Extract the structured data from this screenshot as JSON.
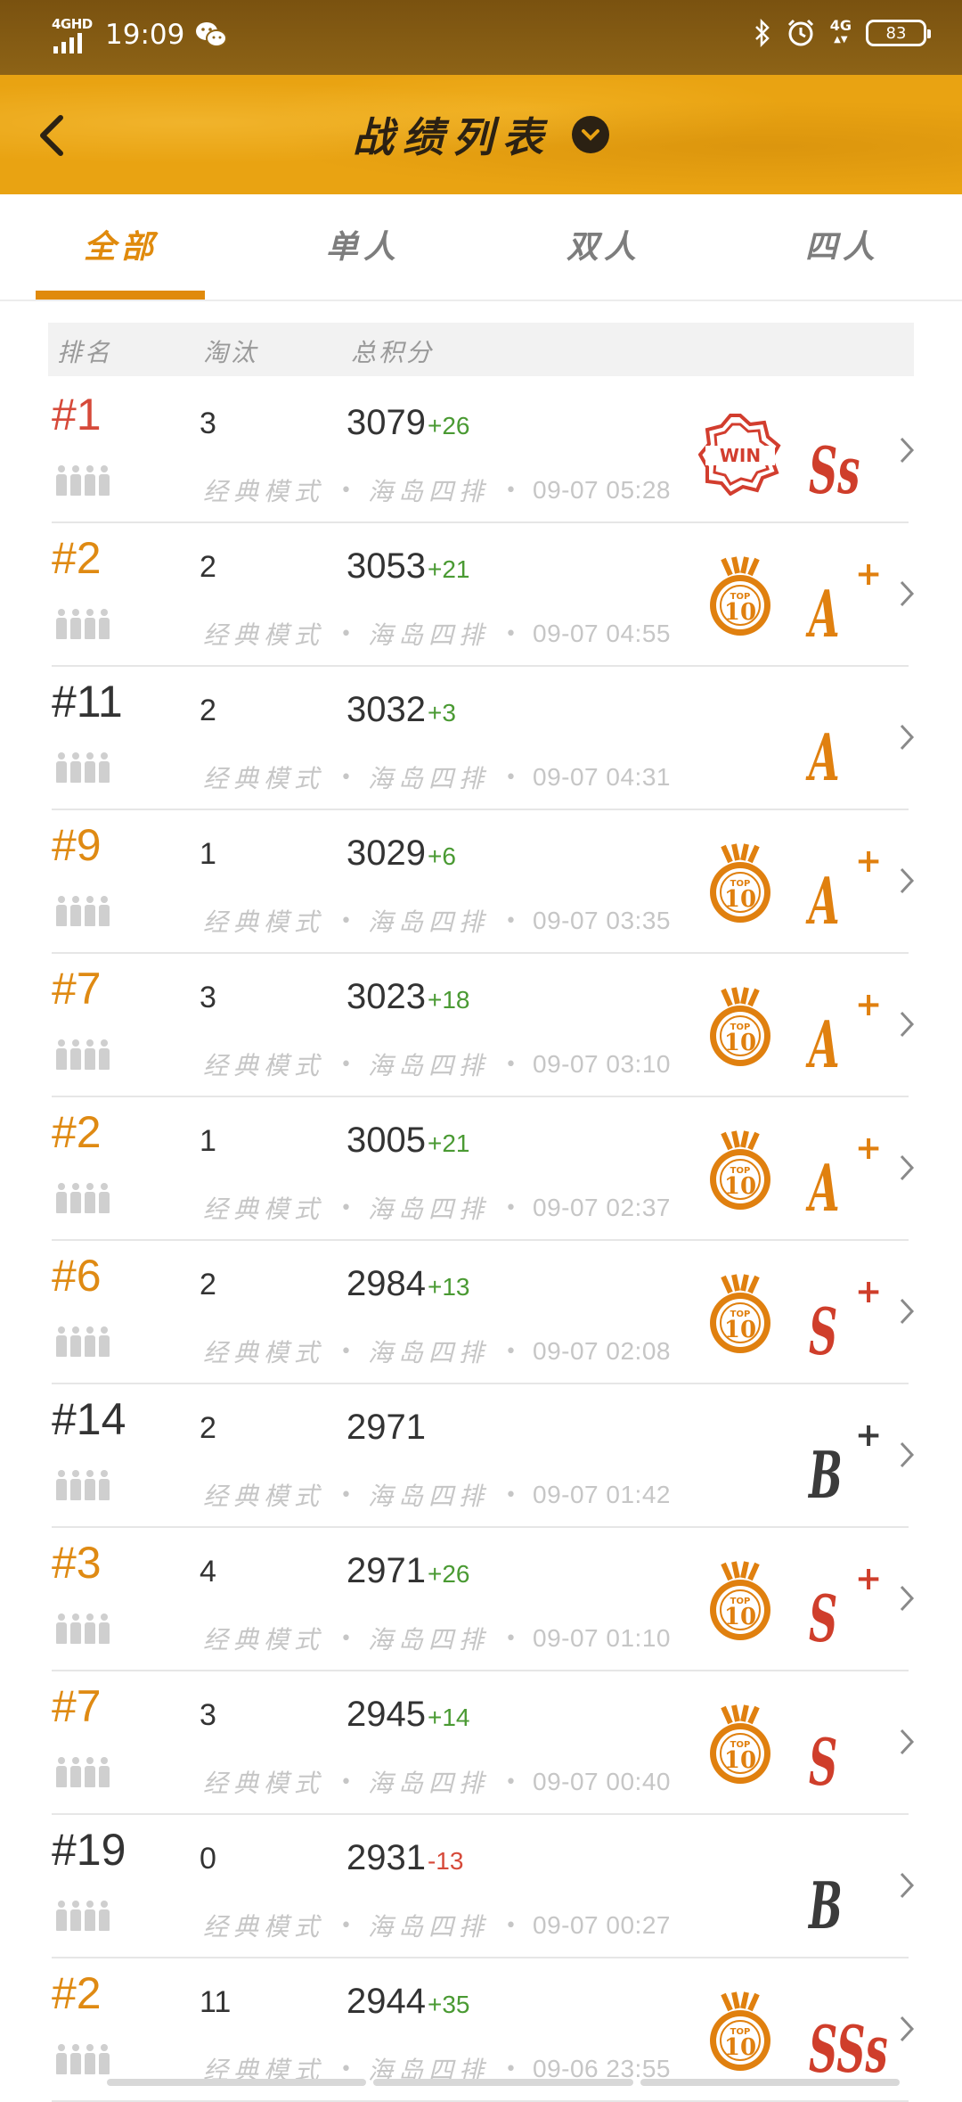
{
  "status_bar": {
    "network": "4GHD",
    "time": "19:09",
    "network_right": "4G",
    "battery": "83",
    "icons": [
      "signal-icon",
      "wechat-icon",
      "bluetooth-icon",
      "alarm-icon",
      "battery-icon"
    ]
  },
  "header": {
    "title": "战绩列表",
    "back_icon": "back-arrow-icon",
    "dropdown_icon": "chevron-down-circle-icon"
  },
  "tabs": [
    {
      "label": "全部",
      "active": true
    },
    {
      "label": "单人",
      "active": false
    },
    {
      "label": "双人",
      "active": false
    },
    {
      "label": "四人",
      "active": false
    }
  ],
  "table_header": {
    "rank": "排名",
    "kills": "淘汰",
    "score": "总积分"
  },
  "rows": [
    {
      "rank": "#1",
      "rank_color": "red",
      "kills": "3",
      "score": "3079",
      "delta": "+26",
      "delta_sign": "pos",
      "mode": "经典模式",
      "map": "海岛四排",
      "time": "09-07 05:28",
      "badge": "win",
      "grade": "Ss",
      "grade_plus": "",
      "grade_color": "red"
    },
    {
      "rank": "#2",
      "rank_color": "gold",
      "kills": "2",
      "score": "3053",
      "delta": "+21",
      "delta_sign": "pos",
      "mode": "经典模式",
      "map": "海岛四排",
      "time": "09-07 04:55",
      "badge": "top10",
      "grade": "A",
      "grade_plus": "+",
      "grade_color": "orange"
    },
    {
      "rank": "#11",
      "rank_color": "dark",
      "kills": "2",
      "score": "3032",
      "delta": "+3",
      "delta_sign": "pos",
      "mode": "经典模式",
      "map": "海岛四排",
      "time": "09-07 04:31",
      "badge": "none",
      "grade": "A",
      "grade_plus": "",
      "grade_color": "orange"
    },
    {
      "rank": "#9",
      "rank_color": "gold",
      "kills": "1",
      "score": "3029",
      "delta": "+6",
      "delta_sign": "pos",
      "mode": "经典模式",
      "map": "海岛四排",
      "time": "09-07 03:35",
      "badge": "top10",
      "grade": "A",
      "grade_plus": "+",
      "grade_color": "orange"
    },
    {
      "rank": "#7",
      "rank_color": "gold",
      "kills": "3",
      "score": "3023",
      "delta": "+18",
      "delta_sign": "pos",
      "mode": "经典模式",
      "map": "海岛四排",
      "time": "09-07 03:10",
      "badge": "top10",
      "grade": "A",
      "grade_plus": "+",
      "grade_color": "orange"
    },
    {
      "rank": "#2",
      "rank_color": "gold",
      "kills": "1",
      "score": "3005",
      "delta": "+21",
      "delta_sign": "pos",
      "mode": "经典模式",
      "map": "海岛四排",
      "time": "09-07 02:37",
      "badge": "top10",
      "grade": "A",
      "grade_plus": "+",
      "grade_color": "orange"
    },
    {
      "rank": "#6",
      "rank_color": "gold",
      "kills": "2",
      "score": "2984",
      "delta": "+13",
      "delta_sign": "pos",
      "mode": "经典模式",
      "map": "海岛四排",
      "time": "09-07 02:08",
      "badge": "top10",
      "grade": "S",
      "grade_plus": "+",
      "grade_color": "red"
    },
    {
      "rank": "#14",
      "rank_color": "dark",
      "kills": "2",
      "score": "2971",
      "delta": "",
      "delta_sign": "pos",
      "mode": "经典模式",
      "map": "海岛四排",
      "time": "09-07 01:42",
      "badge": "none",
      "grade": "B",
      "grade_plus": "+",
      "grade_color": "dark"
    },
    {
      "rank": "#3",
      "rank_color": "gold",
      "kills": "4",
      "score": "2971",
      "delta": "+26",
      "delta_sign": "pos",
      "mode": "经典模式",
      "map": "海岛四排",
      "time": "09-07 01:10",
      "badge": "top10",
      "grade": "S",
      "grade_plus": "+",
      "grade_color": "red"
    },
    {
      "rank": "#7",
      "rank_color": "gold",
      "kills": "3",
      "score": "2945",
      "delta": "+14",
      "delta_sign": "pos",
      "mode": "经典模式",
      "map": "海岛四排",
      "time": "09-07 00:40",
      "badge": "top10",
      "grade": "S",
      "grade_plus": "",
      "grade_color": "red"
    },
    {
      "rank": "#19",
      "rank_color": "dark",
      "kills": "0",
      "score": "2931",
      "delta": "-13",
      "delta_sign": "neg",
      "mode": "经典模式",
      "map": "海岛四排",
      "time": "09-07 00:27",
      "badge": "none",
      "grade": "B",
      "grade_plus": "",
      "grade_color": "dark"
    },
    {
      "rank": "#2",
      "rank_color": "gold",
      "kills": "11",
      "score": "2944",
      "delta": "+35",
      "delta_sign": "pos",
      "mode": "经典模式",
      "map": "海岛四排",
      "time": "09-06 23:55",
      "badge": "top10",
      "grade": "SSs",
      "grade_plus": "",
      "grade_color": "red"
    }
  ],
  "badge_labels": {
    "win": "WIN",
    "top10_small": "TOP",
    "top10_big": "10"
  },
  "colors": {
    "header_bg": "#e9a312",
    "accent": "#e08a0c",
    "positive": "#4a9a33",
    "negative": "#d64a3a"
  }
}
